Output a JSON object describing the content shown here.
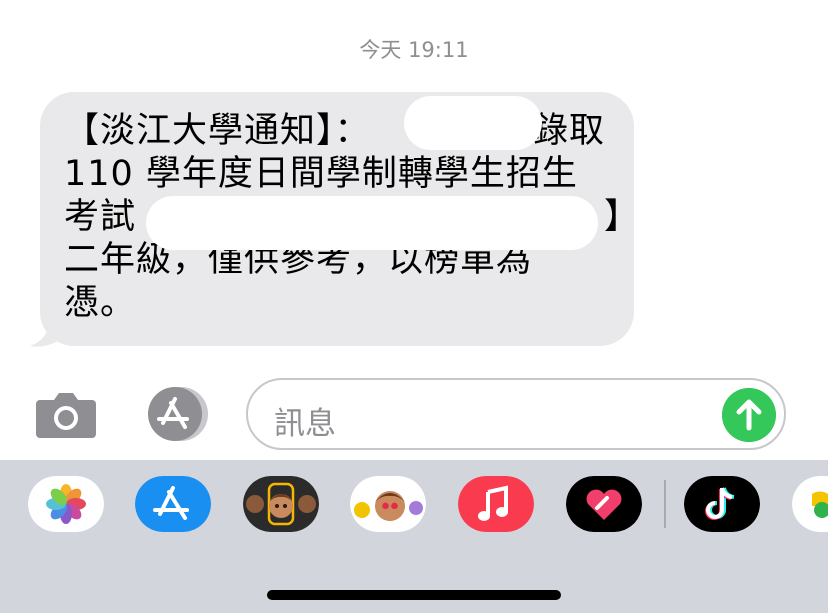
{
  "conversation": {
    "timestamp": "今天 19:11",
    "message_lines": [
      "【淡江大學通知】：　　　　　錄取",
      "110 學年度日間學制轉學生招生",
      "考試（　　　　　　　　　　　　】",
      "二年級，僅供參考，以榜單為",
      "憑。"
    ]
  },
  "composer": {
    "placeholder": "訊息",
    "camera_icon": "camera-icon",
    "appstore_icon": "appstore-icon",
    "send_icon": "arrow-up-icon"
  },
  "app_drawer": {
    "apps": [
      {
        "name": "photos",
        "icon": "photos-icon"
      },
      {
        "name": "app-store",
        "icon": "appstore-icon"
      },
      {
        "name": "memoji-camera",
        "icon": "memoji-icon"
      },
      {
        "name": "memoji-stickers",
        "icon": "memoji-stickers-icon"
      },
      {
        "name": "music",
        "icon": "music-note-icon"
      },
      {
        "name": "digital-touch",
        "icon": "heart-icon"
      },
      {
        "name": "tiktok",
        "icon": "tiktok-icon"
      },
      {
        "name": "more-app",
        "icon": "partial-app-icon"
      }
    ]
  },
  "colors": {
    "bubble": "#e9e9eb",
    "send": "#34c759",
    "music": "#fa3a4f",
    "appstore": "#1a8ff2",
    "drawer": "#d2d5db"
  }
}
